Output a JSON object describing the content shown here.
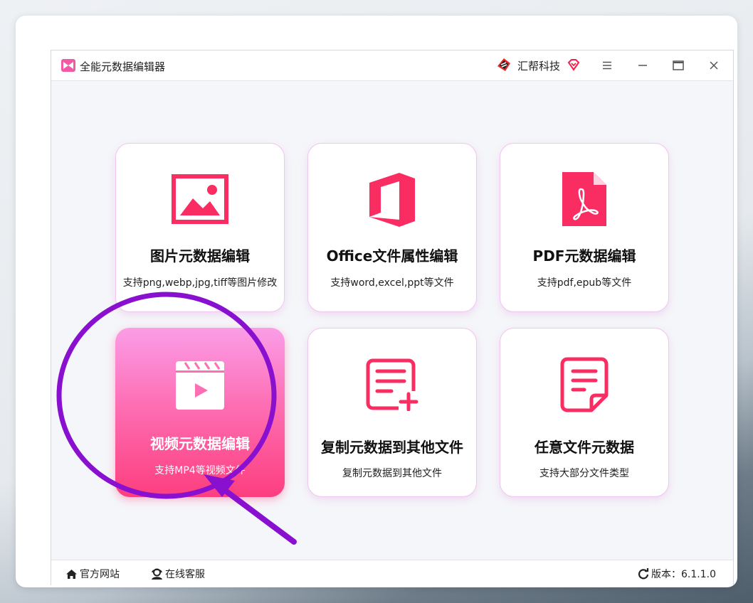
{
  "app": {
    "title": "全能元数据编辑器",
    "brand": "汇帮科技",
    "window_controls": [
      "menu-icon",
      "minimize-icon",
      "maximize-icon",
      "close-icon"
    ]
  },
  "cards": [
    {
      "title": "图片元数据编辑",
      "desc": "支持png,webp,jpg,tiff等图片修改",
      "icon": "image-icon"
    },
    {
      "title": "Office文件属性编辑",
      "desc": "支持word,excel,ppt等文件",
      "icon": "office-icon"
    },
    {
      "title": "PDF元数据编辑",
      "desc": "支持pdf,epub等文件",
      "icon": "pdf-icon"
    },
    {
      "title": "视频元数据编辑",
      "desc": "支持MP4等视频文件",
      "icon": "video-clapper-icon",
      "selected": true
    },
    {
      "title": "复制元数据到其他文件",
      "desc": "复制元数据到其他文件",
      "icon": "list-add-icon"
    },
    {
      "title": "任意文件元数据",
      "desc": "支持大部分文件类型",
      "icon": "document-icon"
    }
  ],
  "footer": {
    "website": "官方网站",
    "support": "在线客服",
    "version": "版本：6.1.1.0"
  },
  "colors": {
    "accent": "#fa2d63",
    "annotation": "#8a10d0",
    "card_border": "#f1c6ef"
  }
}
